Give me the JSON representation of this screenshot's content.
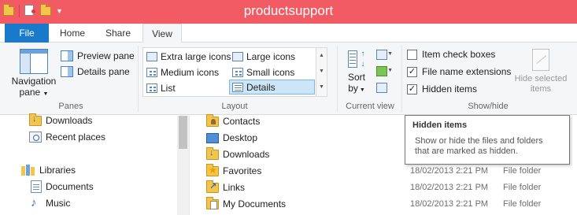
{
  "window": {
    "title": "productsupport",
    "qat_items": [
      "folder-icon",
      "properties-icon",
      "new-folder-icon",
      "customize-dropdown-icon"
    ]
  },
  "tabs": [
    {
      "label": "File"
    },
    {
      "label": "Home"
    },
    {
      "label": "Share"
    },
    {
      "label": "View",
      "active": true
    }
  ],
  "ribbon": {
    "panes": {
      "group_label": "Panes",
      "navigation_pane_line1": "Navigation",
      "navigation_pane_line2": "pane",
      "preview_pane": "Preview pane",
      "details_pane": "Details pane"
    },
    "layout": {
      "group_label": "Layout",
      "options": [
        {
          "label": "Extra large icons"
        },
        {
          "label": "Large icons"
        },
        {
          "label": "Medium icons"
        },
        {
          "label": "Small icons"
        },
        {
          "label": "List"
        },
        {
          "label": "Details",
          "selected": true
        }
      ]
    },
    "current_view": {
      "group_label": "Current view",
      "sort_by_line1": "Sort",
      "sort_by_line2": "by"
    },
    "show_hide": {
      "group_label": "Show/hide",
      "item_check_boxes": {
        "label": "Item check boxes",
        "checked": false
      },
      "file_name_extensions": {
        "label": "File name extensions",
        "checked": true
      },
      "hidden_items": {
        "label": "Hidden items",
        "checked": true
      },
      "hide_selected_line1": "Hide selected",
      "hide_selected_line2": "items"
    }
  },
  "nav_pane": {
    "items": [
      {
        "label": "Downloads",
        "icon": "downloads-folder-icon"
      },
      {
        "label": "Recent places",
        "icon": "recent-places-icon"
      },
      {
        "label": "Libraries",
        "icon": "libraries-icon"
      },
      {
        "label": "Documents",
        "icon": "documents-icon"
      },
      {
        "label": "Music",
        "icon": "music-icon"
      }
    ]
  },
  "files": [
    {
      "name": "Contacts",
      "date": "",
      "type": "",
      "icon": "contacts-folder-icon"
    },
    {
      "name": "Desktop",
      "date": "",
      "type": "",
      "icon": "desktop-folder-icon"
    },
    {
      "name": "Downloads",
      "date": "",
      "type": "",
      "icon": "downloads-folder-icon"
    },
    {
      "name": "Favorites",
      "date": "18/02/2013 2:21 PM",
      "type": "File folder",
      "icon": "favorites-folder-icon"
    },
    {
      "name": "Links",
      "date": "18/02/2013 2:21 PM",
      "type": "File folder",
      "icon": "links-folder-icon"
    },
    {
      "name": "My Documents",
      "date": "18/02/2013 2:21 PM",
      "type": "File folder",
      "icon": "documents-folder-icon"
    }
  ],
  "tooltip": {
    "title": "Hidden items",
    "body_line1": "Show or hide the files and folders",
    "body_line2": "that are marked as hidden."
  },
  "colors": {
    "title_bar": "#f25b63",
    "file_tab": "#1979ca",
    "selected_layout": "#cde6f7"
  }
}
